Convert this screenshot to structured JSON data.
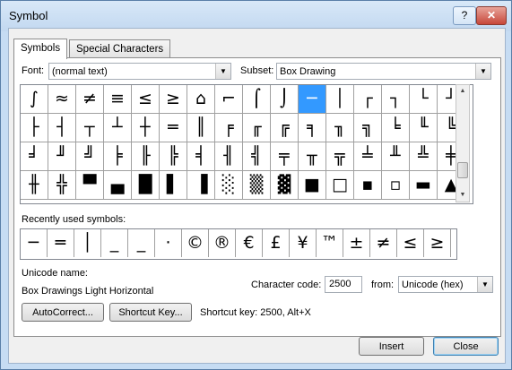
{
  "window": {
    "title": "Symbol",
    "help_label": "?",
    "close_label": "✕"
  },
  "tabs": [
    {
      "label": "Symbols",
      "active": true
    },
    {
      "label": "Special Characters",
      "active": false
    }
  ],
  "font": {
    "label": "Font:",
    "value": "(normal text)"
  },
  "subset": {
    "label": "Subset:",
    "value": "Box Drawing"
  },
  "grid": {
    "selected_index": 10,
    "symbols": [
      [
        "∫",
        "≈",
        "≠",
        "≡",
        "≤",
        "≥",
        "⌂",
        "⌐",
        "⌠",
        "⌡",
        "─",
        "│",
        "┌",
        "┐",
        "└",
        "┘"
      ],
      [
        "├",
        "┤",
        "┬",
        "┴",
        "┼",
        "═",
        "║",
        "╒",
        "╓",
        "╔",
        "╕",
        "╖",
        "╗",
        "╘",
        "╙",
        "╚"
      ],
      [
        "╛",
        "╜",
        "╝",
        "╞",
        "╟",
        "╠",
        "╡",
        "╢",
        "╣",
        "╤",
        "╥",
        "╦",
        "╧",
        "╨",
        "╩",
        "╪"
      ],
      [
        "╫",
        "╬",
        "▀",
        "▄",
        "█",
        "▌",
        "▐",
        "░",
        "▒",
        "▓",
        "■",
        "□",
        "▪",
        "▫",
        "▬",
        "▲"
      ]
    ]
  },
  "scrollbar": {
    "up": "▲",
    "down": "▼"
  },
  "recent": {
    "label": "Recently used symbols:",
    "symbols": [
      "─",
      "═",
      "│",
      "_",
      "_",
      "·",
      "©",
      "®",
      "€",
      "£",
      "¥",
      "™",
      "±",
      "≠",
      "≤",
      "≥"
    ]
  },
  "unicode_name": {
    "label": "Unicode name:",
    "value": "Box Drawings Light Horizontal"
  },
  "character_code": {
    "label": "Character code:",
    "value": "2500"
  },
  "from": {
    "label": "from:",
    "value": "Unicode (hex)"
  },
  "buttons": {
    "autocorrect": "AutoCorrect...",
    "shortcut_key": "Shortcut Key...",
    "insert": "Insert",
    "close": "Close"
  },
  "shortcut_info": "Shortcut key: 2500, Alt+X"
}
